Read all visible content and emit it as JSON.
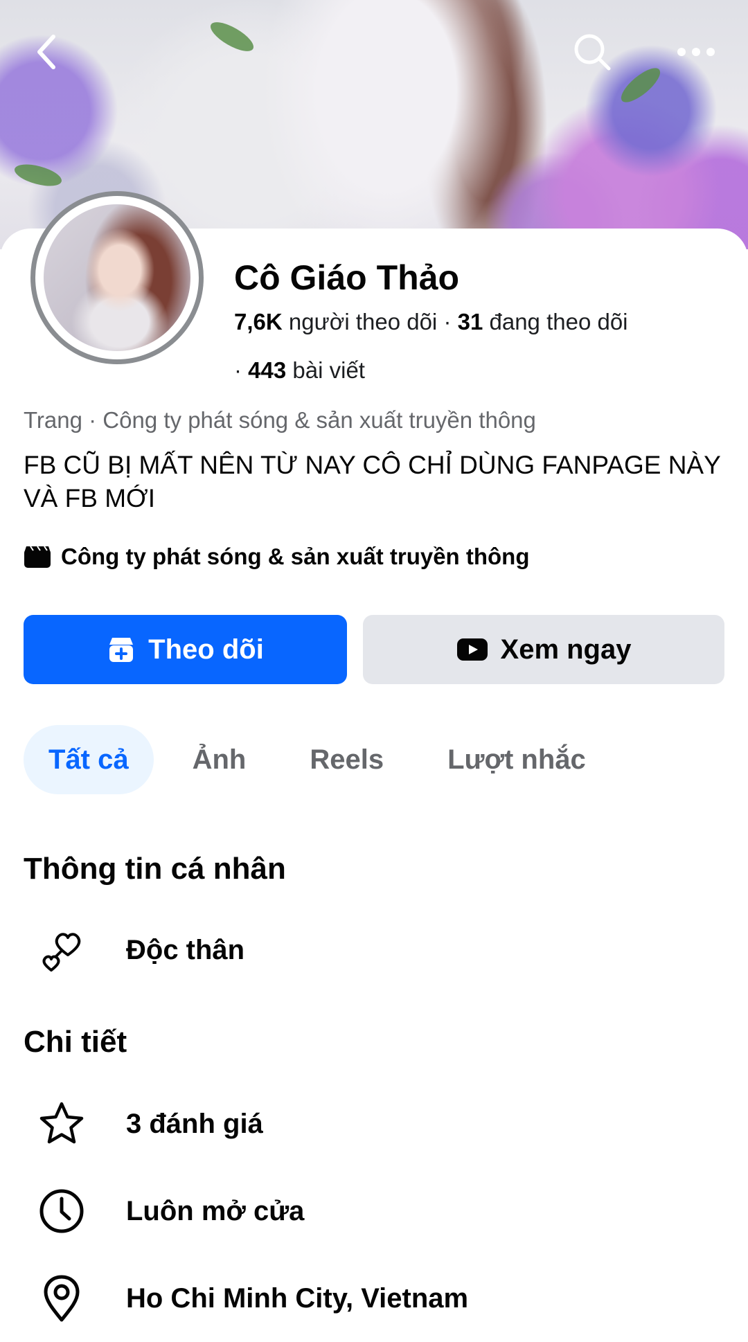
{
  "topbar": {
    "back_icon": "chevron-left-icon",
    "search_icon": "search-icon",
    "more_icon": "more-horizontal-icon"
  },
  "profile": {
    "name": "Cô Giáo Thảo",
    "followers_count": "7,6K",
    "followers_label": "người theo dõi",
    "following_count": "31",
    "following_label": "đang theo dõi",
    "posts_count": "443",
    "posts_label": "bài viết",
    "category_line": "Trang · Công ty phát sóng & sản xuất truyền thông",
    "bio": "FB CŨ BỊ MẤT NÊN TỪ NAY CÔ CHỈ DÙNG FANPAGE NÀY VÀ FB MỚI",
    "category_detail": "Công ty phát sóng & sản xuất truyền thông"
  },
  "actions": {
    "follow_label": "Theo dõi",
    "watch_label": "Xem ngay",
    "follow_color": "#0866ff"
  },
  "tabs": [
    {
      "label": "Tất cả",
      "active": true
    },
    {
      "label": "Ảnh",
      "active": false
    },
    {
      "label": "Reels",
      "active": false
    },
    {
      "label": "Lượt nhắc",
      "active": false
    }
  ],
  "personal_info": {
    "title": "Thông tin cá nhân",
    "items": [
      {
        "icon": "hearts-icon",
        "text": "Độc thân"
      }
    ]
  },
  "details": {
    "title": "Chi tiết",
    "items": [
      {
        "icon": "star-icon",
        "text": "3 đánh giá"
      },
      {
        "icon": "clock-icon",
        "text": "Luôn mở cửa"
      },
      {
        "icon": "location-pin-icon",
        "text": "Ho Chi Minh City, Vietnam"
      }
    ]
  }
}
